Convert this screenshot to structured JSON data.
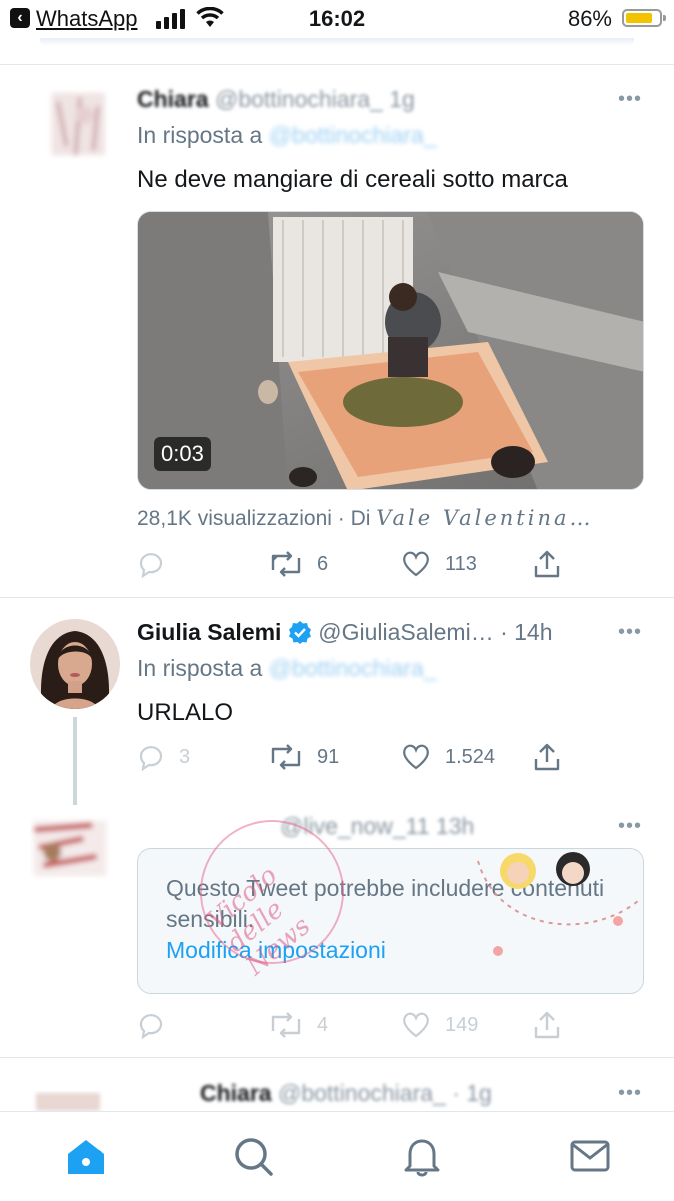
{
  "status_bar": {
    "back_app": "WhatsApp",
    "time": "16:02",
    "battery_pct": "86%",
    "battery_level": 0.86
  },
  "tweet1": {
    "name": "Chiara",
    "handle": "@bottinochiara_",
    "time": "1g",
    "reply_prefix": "In risposta a",
    "reply_handle": "@bottinochiara_",
    "text": "Ne deve mangiare di cereali sotto marca",
    "video_duration": "0:03",
    "views": "28,1K visualizzazioni · Di",
    "views_author": "Vale Valentina…",
    "retweets": "6",
    "likes": "113",
    "more": "•••"
  },
  "tweet2": {
    "name": "Giulia Salemi",
    "handle": "@GiuliaSalemi…",
    "time": "· 14h",
    "reply_prefix": "In risposta a",
    "reply_handle": "@bottinochiara_",
    "text": "URLALO",
    "replies": "3",
    "retweets": "91",
    "likes": "1.524",
    "more": "•••"
  },
  "tweet3": {
    "handle": "@live_now_11",
    "time": "13h",
    "sensitive_text": "Questo Tweet potrebbe includere contenuti sensibili.",
    "sensitive_link": "Modifica impostazioni",
    "retweets": "4",
    "likes": "149",
    "more": "•••"
  },
  "tweet4": {
    "name": "Chiara",
    "handle": "@bottinochiara_",
    "time": "· 1g",
    "more": "•••"
  },
  "watermark": "Vicolo delle News",
  "colors": {
    "accent": "#1da1f2",
    "muted": "#657786",
    "verified": "#1da1f2",
    "battery": "#f4c300"
  },
  "tabbar": {
    "items": [
      "home-icon",
      "search-icon",
      "notifications-icon",
      "messages-icon"
    ]
  }
}
